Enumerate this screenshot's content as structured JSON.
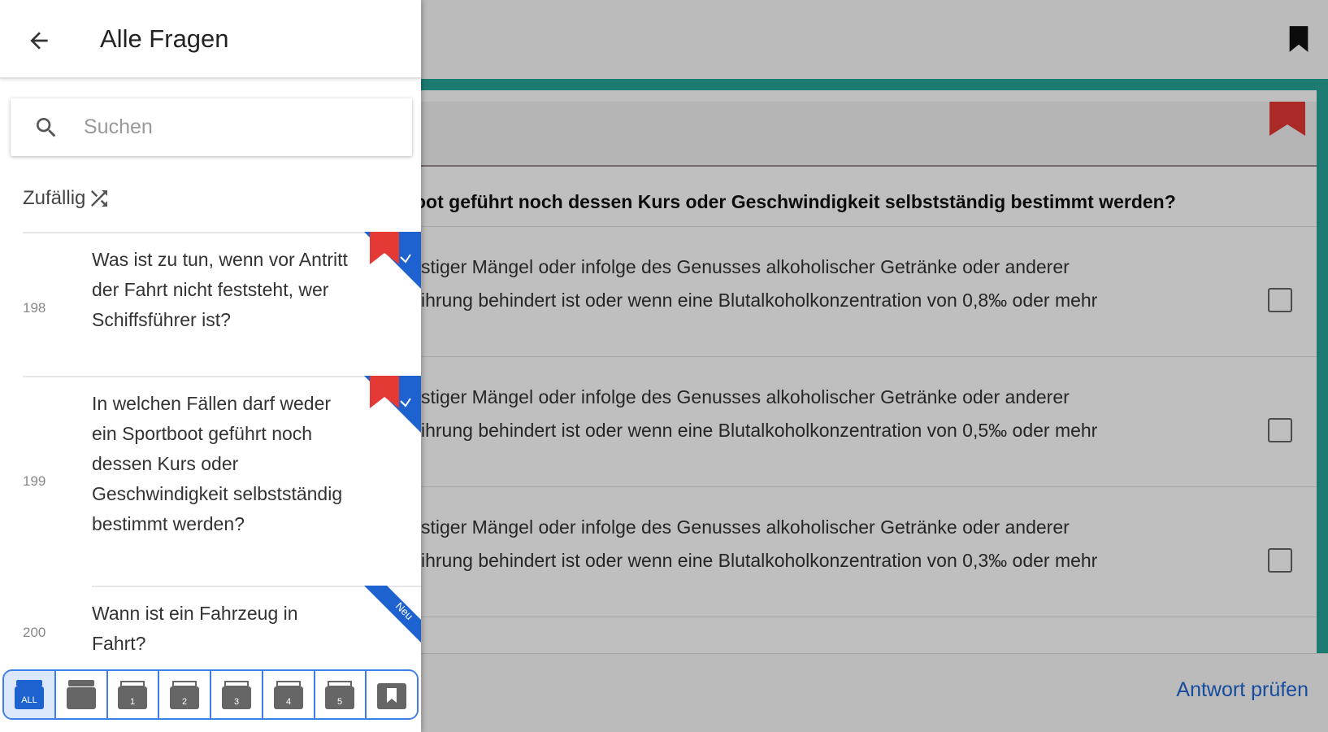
{
  "drawer": {
    "title": "Alle Fragen",
    "search_placeholder": "Suchen",
    "random_label": "Zufällig",
    "questions": [
      {
        "number": "198",
        "text": "Was ist zu tun, wenn vor Antritt der Fahrt nicht feststeht, wer Schiffsführer ist?",
        "badge": "bookmark"
      },
      {
        "number": "199",
        "text": "In welchen Fällen darf weder ein Sportboot geführt noch dessen Kurs oder Geschwindigkeit selbstständig bestimmt werden?",
        "badge": "bookmark"
      },
      {
        "number": "200",
        "text": "Wann ist ein Fahrzeug in Fahrt?",
        "badge": "new",
        "badge_label": "Neu"
      }
    ],
    "boxes": [
      {
        "name": "all",
        "label": "ALL",
        "selected": true
      },
      {
        "name": "stack",
        "label": ""
      },
      {
        "name": "1",
        "label": "1"
      },
      {
        "name": "2",
        "label": "2"
      },
      {
        "name": "3",
        "label": "3"
      },
      {
        "name": "4",
        "label": "4"
      },
      {
        "name": "5",
        "label": "5"
      },
      {
        "name": "bookmarked",
        "label": ""
      }
    ]
  },
  "main": {
    "question_visible": "oot geführt noch dessen Kurs oder Geschwindigkeit selbstständig bestimmt werden?",
    "answers": [
      {
        "line1": "stiger Mängel oder infolge des Genusses alkoholischer Getränke oder anderer",
        "line2": "ihrung behindert ist oder wenn eine Blutalkoholkonzentration von 0,8‰ oder mehr",
        "checked": false
      },
      {
        "line1": "stiger Mängel oder infolge des Genusses alkoholischer Getränke oder anderer",
        "line2": "ihrung behindert ist oder wenn eine Blutalkoholkonzentration von 0,5‰ oder mehr",
        "checked": false
      },
      {
        "line1": "stiger Mängel oder infolge des Genusses alkoholischer Getränke oder anderer",
        "line2": "ihrung behindert ist oder wenn eine Blutalkoholkonzentration von 0,3‰ oder mehr",
        "checked": false
      }
    ],
    "check_button": "Antwort prüfen"
  },
  "colors": {
    "accent_teal": "#26a69a",
    "ribbon_red": "#e53935",
    "ribbon_blue": "#1e62d0",
    "link_blue": "#1e64d2"
  }
}
